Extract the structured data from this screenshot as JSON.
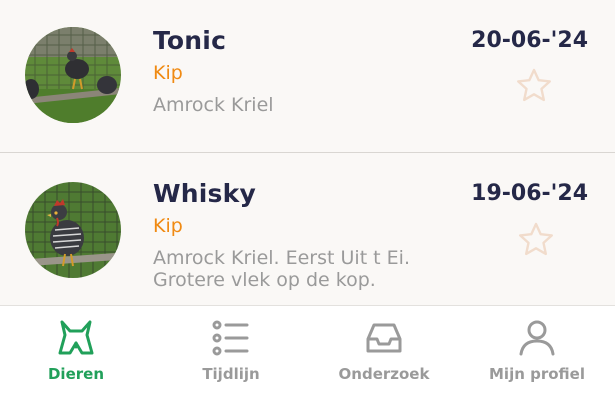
{
  "animals": [
    {
      "name": "Tonic",
      "species": "Kip",
      "description_lines": [
        "Amrock Kriel"
      ],
      "date": "20-06-'24",
      "favorite": false
    },
    {
      "name": "Whisky",
      "species": "Kip",
      "description_lines": [
        "Amrock Kriel. Eerst Uit t Ei.",
        "Grotere vlek op de kop."
      ],
      "date": "19-06-'24",
      "favorite": false
    }
  ],
  "tabbar": {
    "tabs": [
      {
        "label": "Dieren",
        "icon": "animal-head-icon",
        "active": true
      },
      {
        "label": "Tijdlijn",
        "icon": "list-icon",
        "active": false
      },
      {
        "label": "Onderzoek",
        "icon": "inbox-icon",
        "active": false
      },
      {
        "label": "Mijn profiel",
        "icon": "user-icon",
        "active": false
      }
    ]
  },
  "colors": {
    "name": "#252848",
    "species": "#f08a12",
    "description": "#9a9a9a",
    "active_tab": "#21a05a",
    "inactive_tab": "#9a9a9a",
    "star_outline": "#f1dccc",
    "card_background": "#faf8f6"
  }
}
